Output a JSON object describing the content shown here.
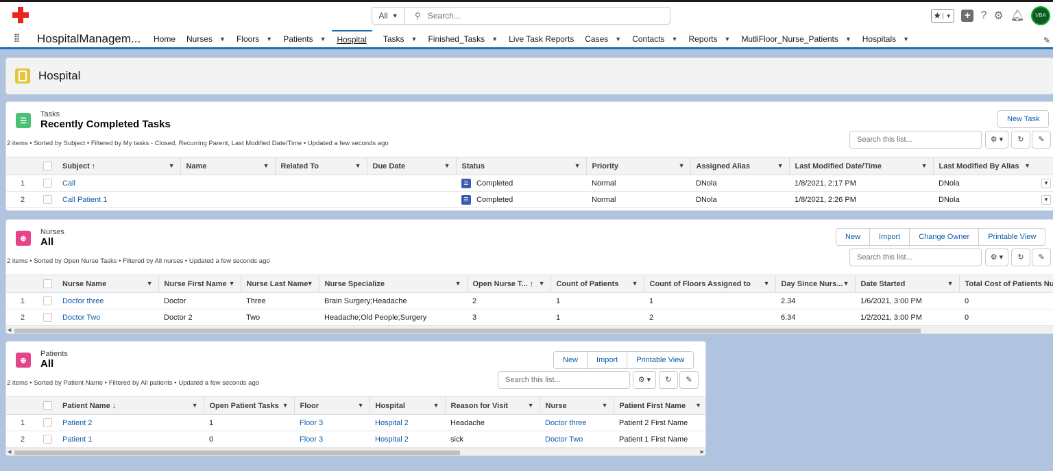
{
  "header": {
    "search_scope": "All",
    "search_placeholder": "Search...",
    "avatar_text": "VBA"
  },
  "nav": {
    "app_name": "HospitalManagem...",
    "items": [
      {
        "label": "Home",
        "chev": false
      },
      {
        "label": "Nurses",
        "chev": true
      },
      {
        "label": "Floors",
        "chev": true
      },
      {
        "label": "Patients",
        "chev": true
      },
      {
        "label": "Hospital",
        "chev": false,
        "active": true
      },
      {
        "label": "Tasks",
        "chev": true
      },
      {
        "label": "Finished_Tasks",
        "chev": true
      },
      {
        "label": "Live Task Reports",
        "chev": false
      },
      {
        "label": "Cases",
        "chev": true
      },
      {
        "label": "Contacts",
        "chev": true
      },
      {
        "label": "Reports",
        "chev": true
      },
      {
        "label": "MutliFloor_Nurse_Patients",
        "chev": true
      },
      {
        "label": "Hospitals",
        "chev": true
      }
    ]
  },
  "page": {
    "title": "Hospital"
  },
  "tasks": {
    "object": "Tasks",
    "list": "Recently Completed Tasks",
    "meta": "2 items • Sorted by Subject • Filtered by My tasks - Closed, Recurring Parent, Last Modified Date/Time • Updated a few seconds ago",
    "new_button": "New Task",
    "search_placeholder": "Search this list...",
    "columns": [
      "Subject ↑",
      "Name",
      "Related To",
      "Due Date",
      "Status",
      "Priority",
      "Assigned Alias",
      "Last Modified Date/Time",
      "Last Modified By Alias"
    ],
    "rows": [
      {
        "n": "1",
        "subject": "Call",
        "status": "Completed",
        "priority": "Normal",
        "alias": "DNola",
        "modified": "1/8/2021, 2:17 PM",
        "modby": "DNola"
      },
      {
        "n": "2",
        "subject": "Call Patient 1",
        "status": "Completed",
        "priority": "Normal",
        "alias": "DNola",
        "modified": "1/8/2021, 2:26 PM",
        "modby": "DNola"
      }
    ]
  },
  "nurses": {
    "object": "Nurses",
    "list": "All",
    "meta": "2 items • Sorted by Open Nurse Tasks • Filtered by All nurses • Updated a few seconds ago",
    "buttons": [
      "New",
      "Import",
      "Change Owner",
      "Printable View"
    ],
    "search_placeholder": "Search this list...",
    "columns": [
      "Nurse Name",
      "Nurse First Name",
      "Nurse Last Name",
      "Nurse Specialize",
      "Open Nurse T... ↑",
      "Count of Patients",
      "Count of Floors Assigned to",
      "Day Since Nurs...",
      "Date Started",
      "Total Cost of Patients Nurs"
    ],
    "rows": [
      {
        "n": "1",
        "name": "Doctor three",
        "first": "Doctor",
        "last": "Three",
        "spec": "Brain Surgery;Headache",
        "open": "2",
        "patients": "1",
        "floors": "1",
        "days": "2.34",
        "started": "1/6/2021, 3:00 PM",
        "cost": "0"
      },
      {
        "n": "2",
        "name": "Doctor Two",
        "first": "Doctor 2",
        "last": "Two",
        "spec": "Headache;Old People;Surgery",
        "open": "3",
        "patients": "1",
        "floors": "2",
        "days": "6.34",
        "started": "1/2/2021, 3:00 PM",
        "cost": "0"
      }
    ]
  },
  "patients": {
    "object": "Patients",
    "list": "All",
    "meta": "2 items • Sorted by Patient Name • Filtered by All patients • Updated a few seconds ago",
    "buttons": [
      "New",
      "Import",
      "Printable View"
    ],
    "search_placeholder": "Search this list...",
    "columns": [
      "Patient Name ↓",
      "Open Patient Tasks",
      "Floor",
      "Hospital",
      "Reason for Visit",
      "Nurse",
      "Patient First Name"
    ],
    "rows": [
      {
        "n": "1",
        "name": "Patient 2",
        "open": "1",
        "floor": "Floor 3",
        "hospital": "Hospital 2",
        "reason": "Headache",
        "nurse": "Doctor three",
        "first": "Patient 2 First Name"
      },
      {
        "n": "2",
        "name": "Patient 1",
        "open": "0",
        "floor": "Floor 3",
        "hospital": "Hospital 2",
        "reason": "sick",
        "nurse": "Doctor Two",
        "first": "Patient 1 First Name"
      }
    ]
  }
}
